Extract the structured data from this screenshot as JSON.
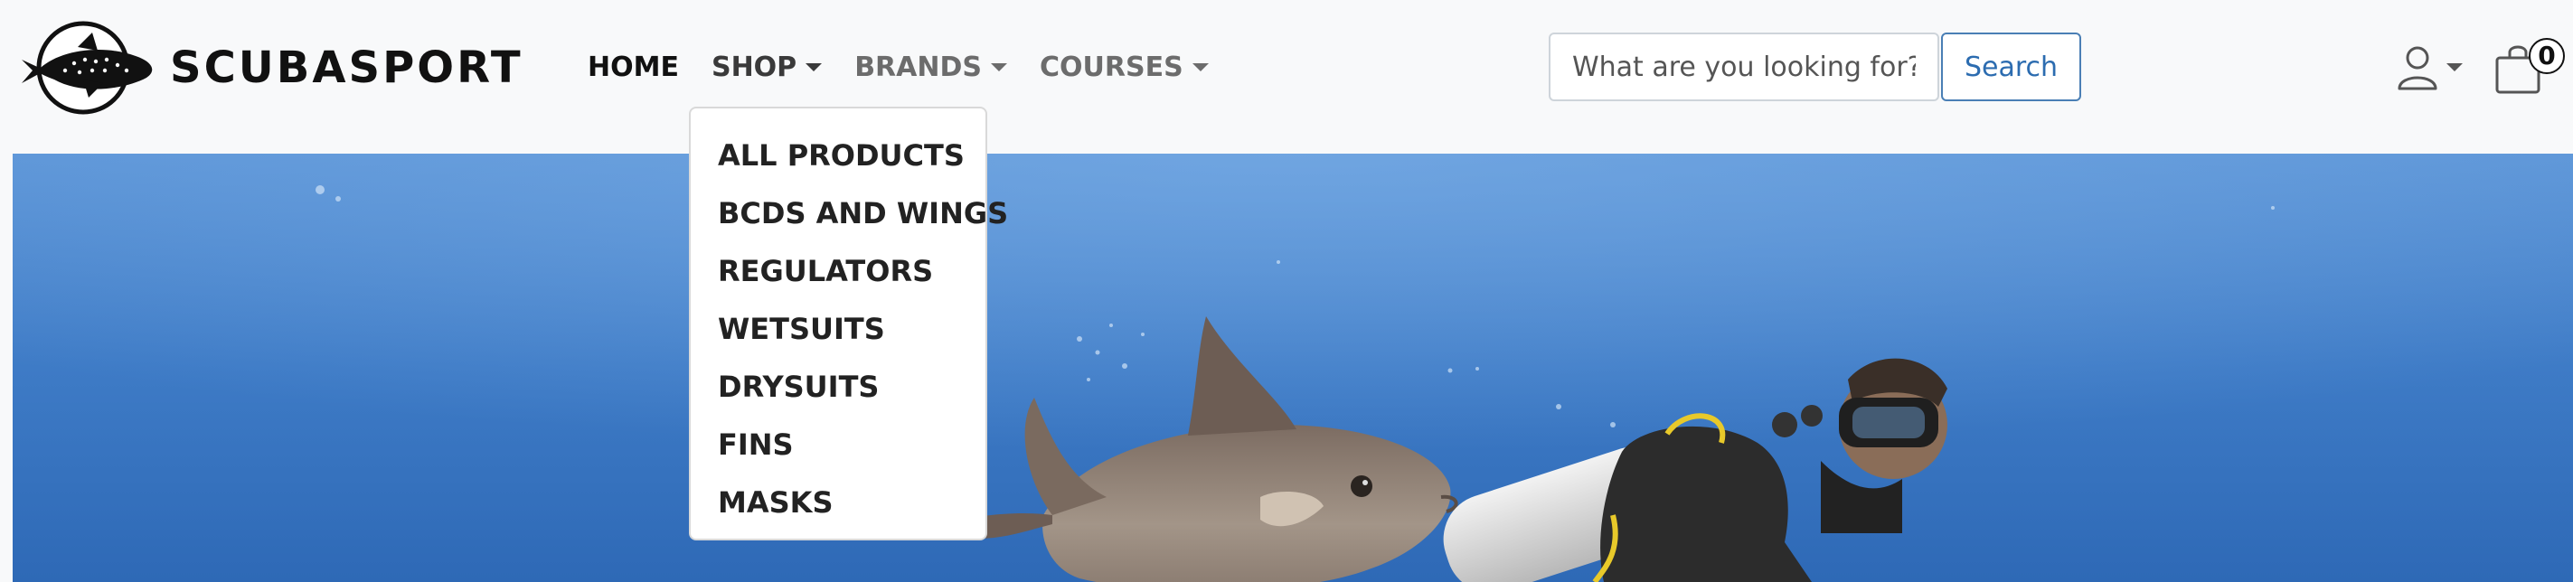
{
  "brand": {
    "name": "SCUBASPORT",
    "logo_icon": "whale-shark-logo-icon"
  },
  "nav": {
    "home": "HOME",
    "shop": "SHOP",
    "brands": "BRANDS",
    "courses": "COURSES"
  },
  "search": {
    "placeholder": "What are you looking for?",
    "button_label": "Search"
  },
  "user_menu": {
    "icon": "user-icon"
  },
  "cart": {
    "icon": "shopping-bag-icon",
    "count": "0"
  },
  "shop_dropdown": {
    "items": [
      "ALL PRODUCTS",
      "BCDS AND WINGS",
      "REGULATORS",
      "WETSUITS",
      "DRYSUITS",
      "FINS",
      "MASKS"
    ]
  },
  "hero": {
    "image": "underwater-scuba-diver-with-triggerfish-photo"
  },
  "colors": {
    "navbar_bg": "#f8f9fa",
    "search_button_border": "#4a7fb5",
    "search_button_text": "#2c6cb0",
    "ocean_blue": "#3d77c4"
  }
}
